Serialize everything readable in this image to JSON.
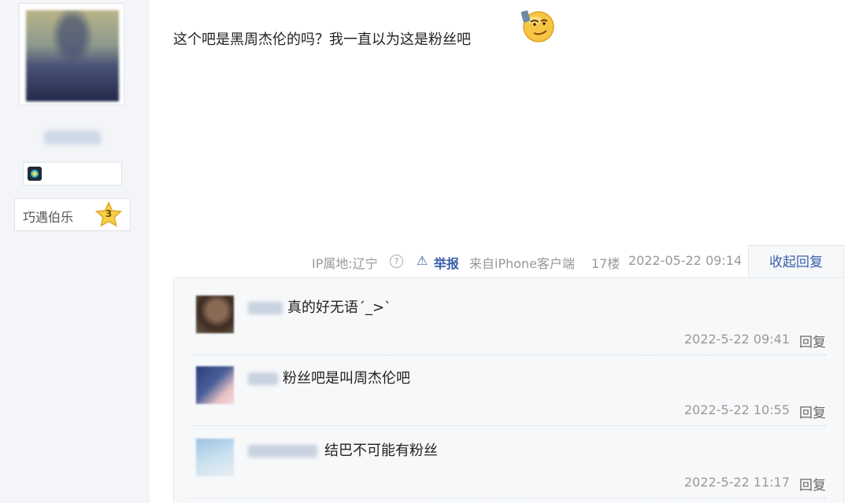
{
  "user": {
    "level_name": "巧遇伯乐",
    "level_number": "3"
  },
  "post": {
    "text": "这个吧是黑周杰伦的吗？我一直以为这是粉丝吧",
    "emoji": "smug-face-emoji"
  },
  "meta": {
    "ip_location": "IP属地:辽宁",
    "help_icon": "?",
    "report_label": "举报",
    "client": "来自iPhone客户端",
    "floor": "17楼",
    "datetime": "2022-05-22 09:14"
  },
  "collapse_label": "收起回复",
  "comments": [
    {
      "text": "真的好无语ˊ_>ˋ",
      "time": "2022-5-22 09:41",
      "reply_label": "回复"
    },
    {
      "text": "粉丝吧是叫周杰伦吧",
      "time": "2022-5-22 10:55",
      "reply_label": "回复"
    },
    {
      "text": "结巴不可能有粉丝",
      "time": "2022-5-22 11:17",
      "reply_label": "回复"
    }
  ],
  "colors": {
    "link": "#3a5fa8",
    "muted": "#999999",
    "panel_bg": "#f3f5f8",
    "comment_bg": "#f6f8fa"
  }
}
